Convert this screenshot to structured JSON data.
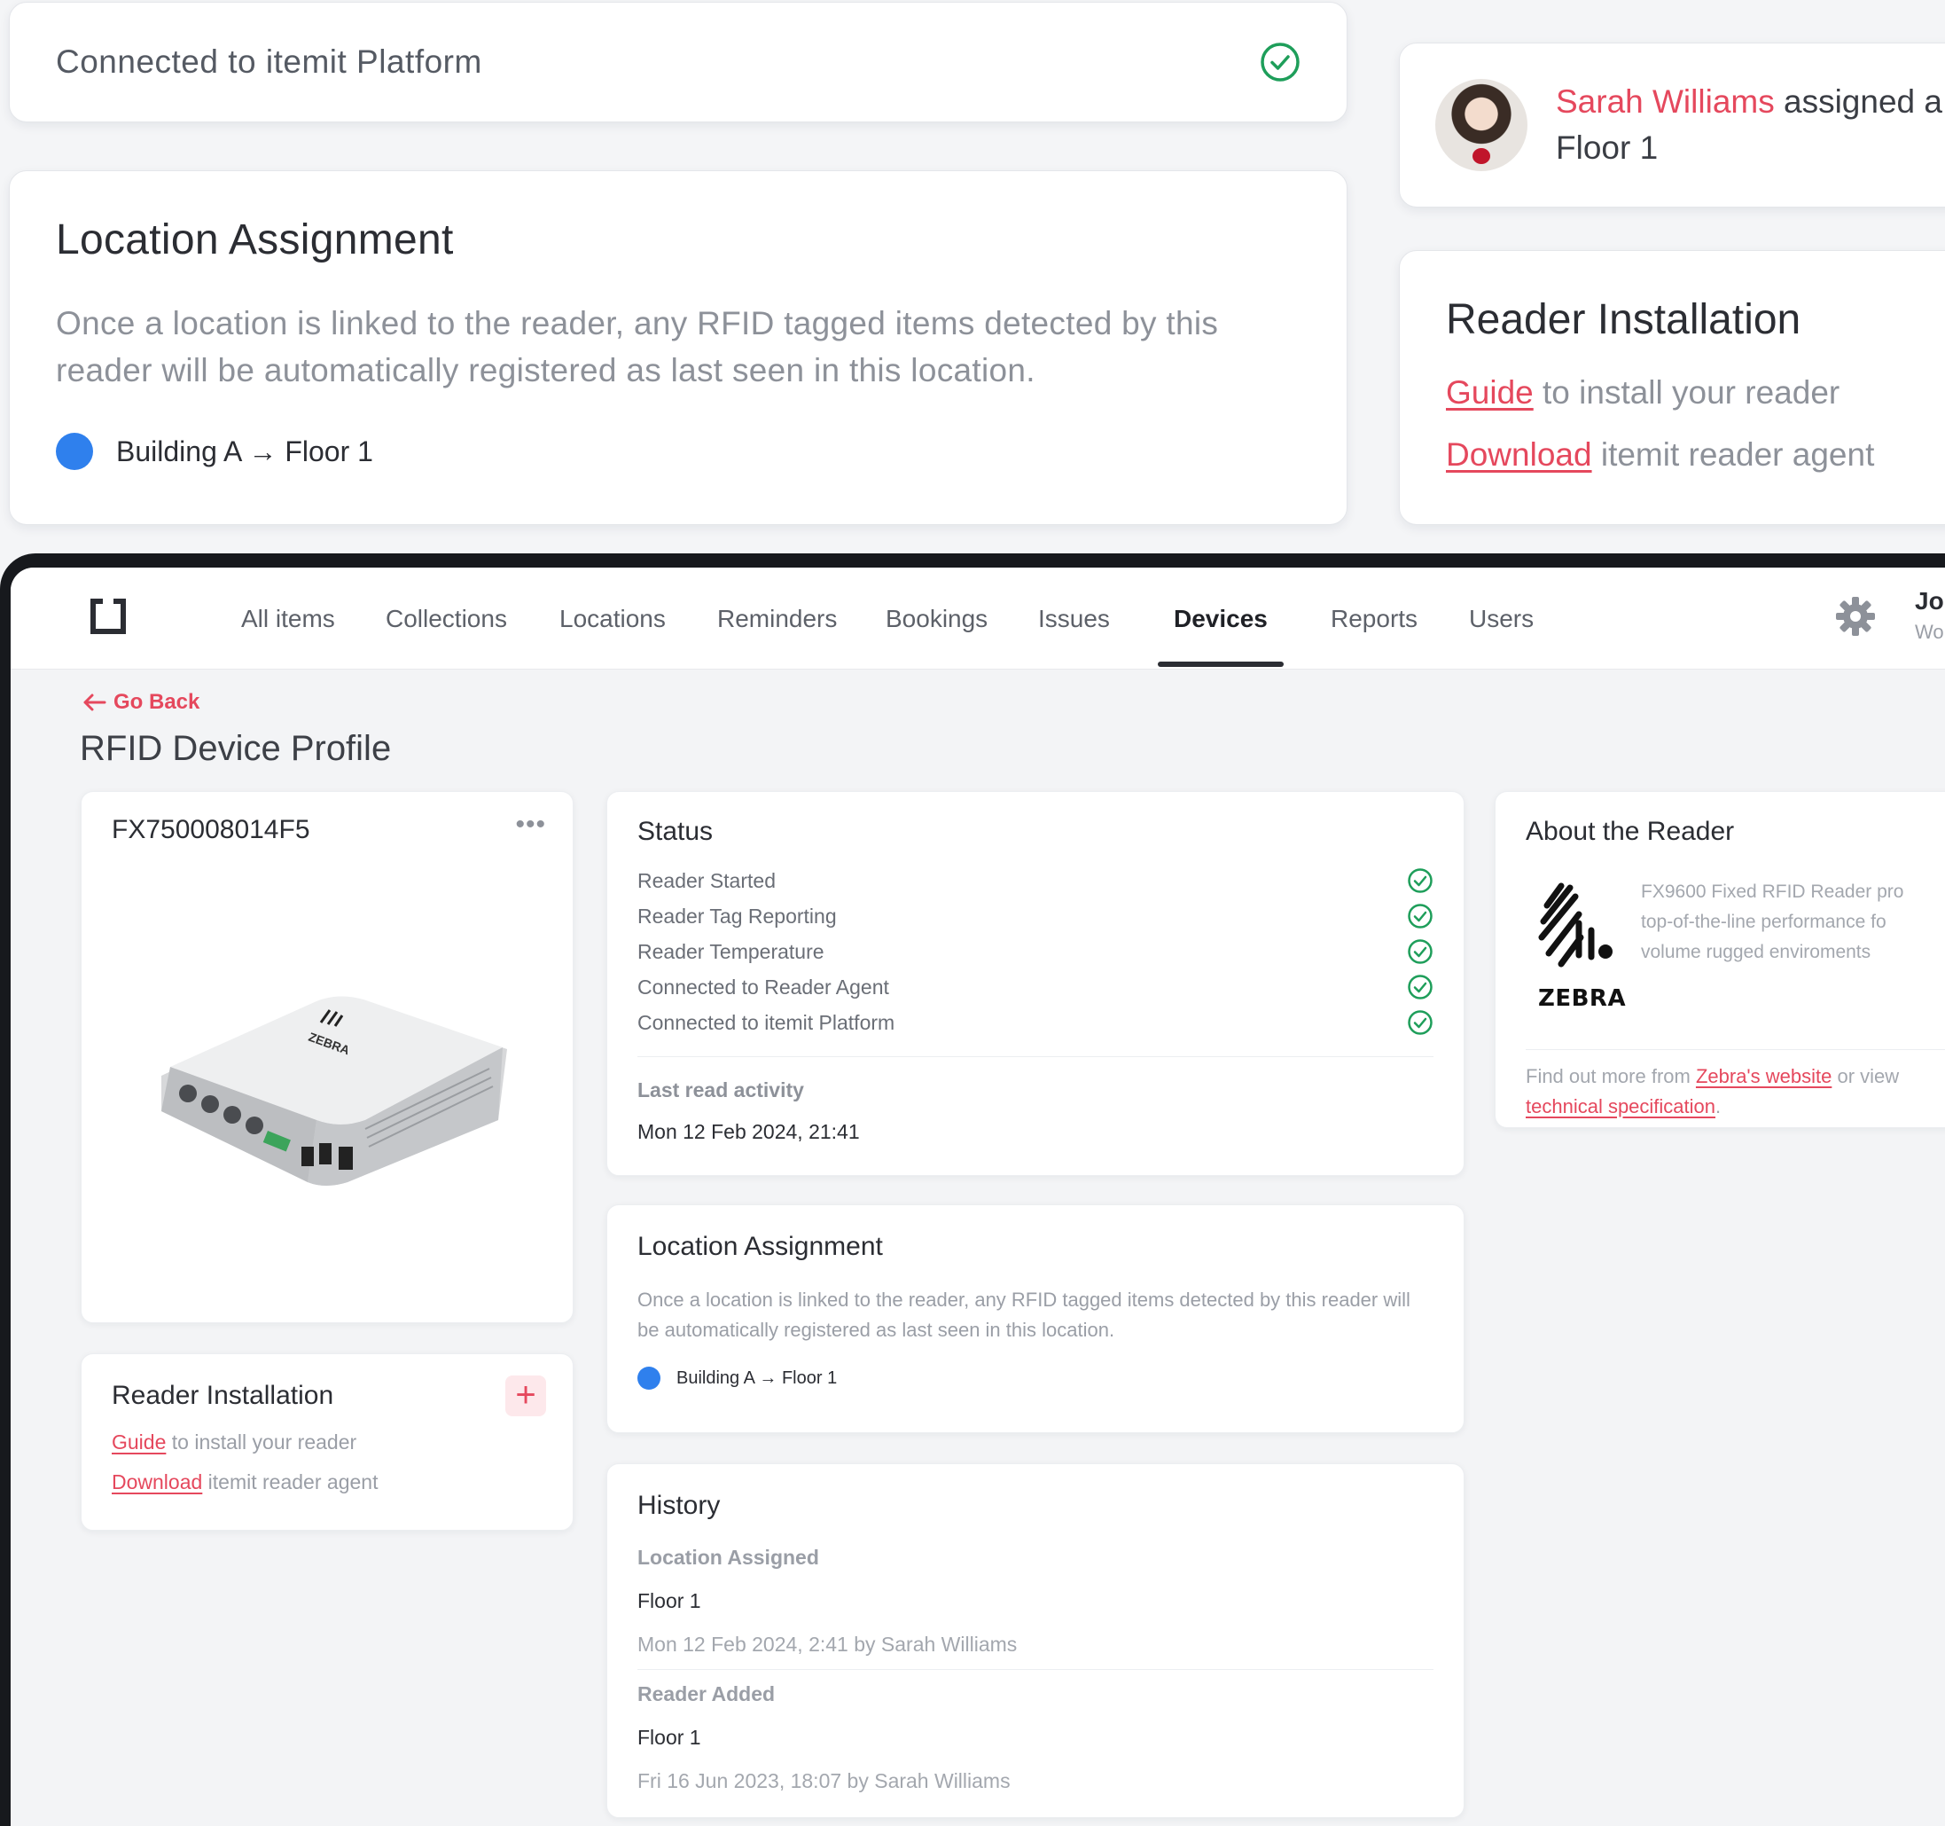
{
  "floating": {
    "connected_text": "Connected to itemit Platform",
    "assignment": {
      "user": "Sarah Williams",
      "action": "assigned a",
      "location": "Floor 1"
    },
    "location_assignment": {
      "title": "Location Assignment",
      "description": "Once a location is linked to the reader, any RFID tagged items detected by this reader will be automatically registered as last seen in this location.",
      "path": "Building A → Floor 1"
    },
    "reader_installation": {
      "title": "Reader Installation",
      "guide_link": "Guide",
      "guide_text": " to install your reader",
      "download_link": "Download",
      "download_text": " itemit reader agent"
    }
  },
  "nav": {
    "items": [
      "All items",
      "Collections",
      "Locations",
      "Reminders",
      "Bookings",
      "Issues",
      "Devices",
      "Reports",
      "Users"
    ],
    "active": "Devices",
    "user_name": "Jol",
    "user_org": "Wor"
  },
  "page": {
    "back_label": "Go Back",
    "title": "RFID Device Profile"
  },
  "device": {
    "id": "FX750008014F5",
    "menu_icon": "more-icon"
  },
  "install": {
    "title": "Reader Installation",
    "guide_link": "Guide",
    "guide_text": " to install your reader",
    "download_link": "Download",
    "download_text": " itemit reader agent"
  },
  "status": {
    "title": "Status",
    "items": [
      "Reader Started",
      "Reader Tag Reporting",
      "Reader Temperature",
      "Connected to Reader Agent",
      "Connected to itemit Platform"
    ],
    "last_read_label": "Last read activity",
    "last_read_value": "Mon 12 Feb 2024, 21:41"
  },
  "location": {
    "title": "Location Assignment",
    "description": "Once a location is linked to the reader, any RFID tagged items detected by this reader will be automatically registered as last seen in this location.",
    "path": "Building A → Floor 1"
  },
  "history": {
    "title": "History",
    "entries": [
      {
        "label": "Location Assigned",
        "value": "Floor 1",
        "meta": "Mon 12 Feb 2024, 2:41 by Sarah Williams"
      },
      {
        "label": "Reader Added",
        "value": "Floor 1",
        "meta": "Fri 16 Jun 2023, 18:07 by Sarah Williams"
      }
    ]
  },
  "about": {
    "title": "About the Reader",
    "brand": "ZEBRA",
    "desc_lines": [
      "FX9600 Fixed RFID Reader pro",
      "top-of-the-line performance fo",
      "volume rugged enviroments"
    ],
    "more_prefix": "Find out more from ",
    "website_link": "Zebra's website",
    "more_middle": " or view",
    "spec_link": "technical specification",
    "more_suffix": "."
  },
  "colors": {
    "accent": "#e5485d",
    "success": "#1e9e5a",
    "location_dot": "#2f80ed"
  }
}
